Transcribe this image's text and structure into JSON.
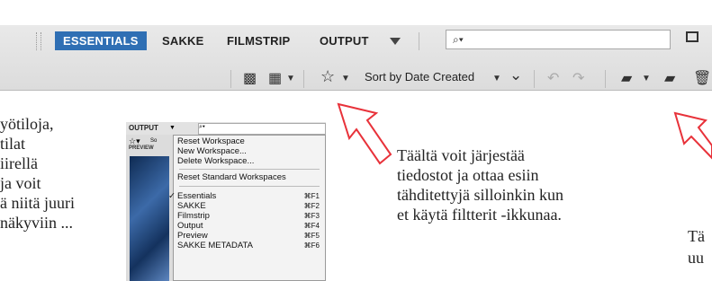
{
  "workspaces": {
    "items": [
      "ESSENTIALS",
      "SAKKE",
      "FILMSTRIP",
      "OUTPUT"
    ],
    "active": "ESSENTIALS"
  },
  "search": {
    "glyph": "⌕▾"
  },
  "toolbar2": {
    "sort_label": "Sort by Date Created",
    "icons": [
      "grid-thumbnail-icon",
      "list-view-icon",
      "star-filter-icon",
      "sort-chevron-icon",
      "rotate-left-icon",
      "rotate-right-icon",
      "open-folder-icon",
      "new-folder-icon",
      "trash-icon"
    ]
  },
  "texts": {
    "left": [
      "yötiloja,",
      "tilat",
      "iirellä",
      "ja voit",
      "ä niitä juuri",
      "näkyviin ..."
    ],
    "middle": [
      "Täältä voit järjestää",
      "tiedostot ja ottaa esiin",
      "tähditettyjä silloinkin kun",
      "et käytä filtterit -ikkunaa."
    ],
    "right": [
      "Tä",
      "uu"
    ]
  },
  "menu": {
    "output_label": "OUTPUT",
    "search_glyph": "⌕▾",
    "side_label": "So",
    "preview_tab": "PREVIEW",
    "groups": [
      [
        "Reset Workspace",
        "New Workspace...",
        "Delete Workspace..."
      ],
      [
        "Reset Standard Workspaces"
      ]
    ],
    "workspace_items": [
      {
        "label": "Essentials",
        "shortcut": "⌘F1",
        "checked": true
      },
      {
        "label": "SAKKE",
        "shortcut": "⌘F2",
        "checked": false
      },
      {
        "label": "Filmstrip",
        "shortcut": "⌘F3",
        "checked": false
      },
      {
        "label": "Output",
        "shortcut": "⌘F4",
        "checked": false
      },
      {
        "label": "Preview",
        "shortcut": "⌘F5",
        "checked": false
      },
      {
        "label": "SAKKE METADATA",
        "shortcut": "⌘F6",
        "checked": false
      }
    ]
  },
  "colors": {
    "active_tab": "#2f6fb4",
    "arrow": "#e8323a"
  }
}
